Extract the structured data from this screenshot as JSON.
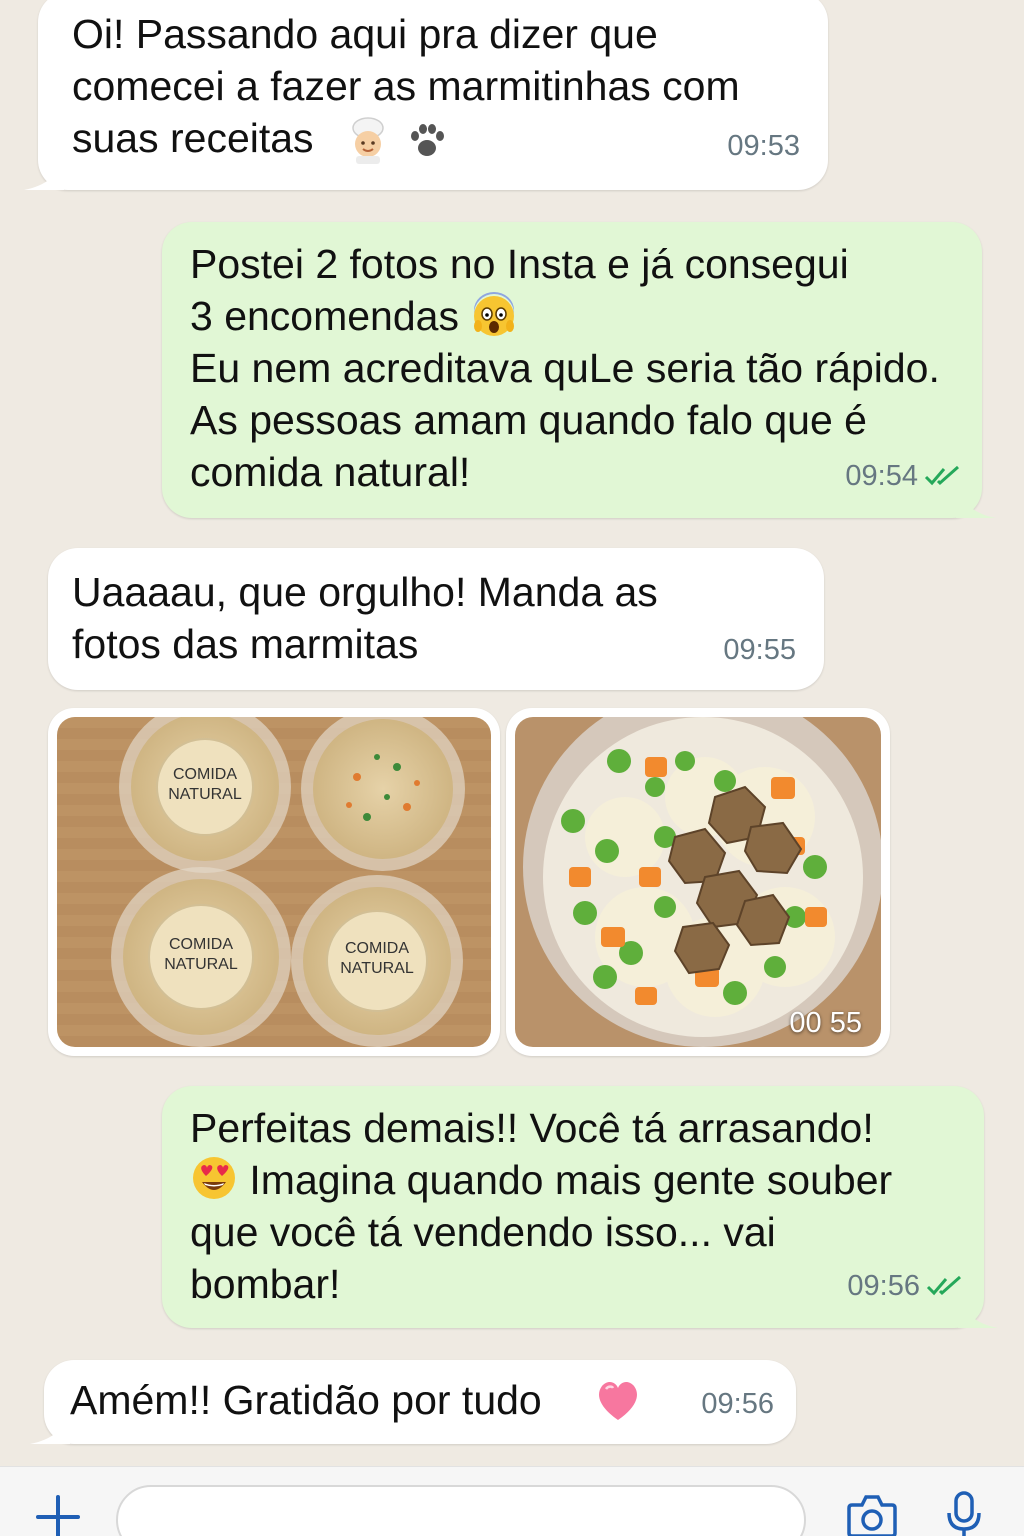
{
  "colors": {
    "background": "#efeae2",
    "incoming_bubble": "#ffffff",
    "outgoing_bubble": "#e1f7d5",
    "timestamp": "#667781",
    "read_ticks": "#25a85a",
    "accent": "#1f5fb5"
  },
  "messages": [
    {
      "direction": "incoming",
      "text": "Oi! Passando aqui pra dizer que\ncomecei a fazer as marmitinhas com\nsuas receitas",
      "emojis": [
        "chef-emoji",
        "paw-prints-emoji"
      ],
      "time": "09:53"
    },
    {
      "direction": "outgoing",
      "text_line1": "Postei 2 fotos no Insta e já consegui",
      "text_line2": "3 encomendas",
      "text_rest": "Eu nem acreditava quLe seria tão rápido.\nAs pessoas amam quando falo que é\ncomida natural!",
      "emojis": [
        "screaming-face-emoji"
      ],
      "time": "09:54",
      "status": "read"
    },
    {
      "direction": "incoming",
      "text": "Uaaaau, que orgulho! Manda as\nfotos das marmitas",
      "time": "09:55"
    },
    {
      "direction": "incoming",
      "type": "photos",
      "photo1_label_a": "COMIDA",
      "photo1_label_b": "NATURAL",
      "photo2_time": "00 55"
    },
    {
      "direction": "outgoing",
      "text_line1": "Perfeitas demais!! Você tá arrasando!",
      "text_line2": " Imagina quando mais gente souber",
      "text_rest": "que você tá vendendo isso... vai\nbombar!",
      "emojis": [
        "heart-eyes-emoji"
      ],
      "time": "09:56",
      "status": "read"
    },
    {
      "direction": "incoming",
      "text": "Amém!! Gratidão por tudo",
      "emojis": [
        "pink-heart-emoji"
      ],
      "time": "09:56"
    }
  ],
  "composer": {
    "placeholder": "",
    "icons": [
      "plus-icon",
      "camera-icon",
      "microphone-icon"
    ]
  }
}
